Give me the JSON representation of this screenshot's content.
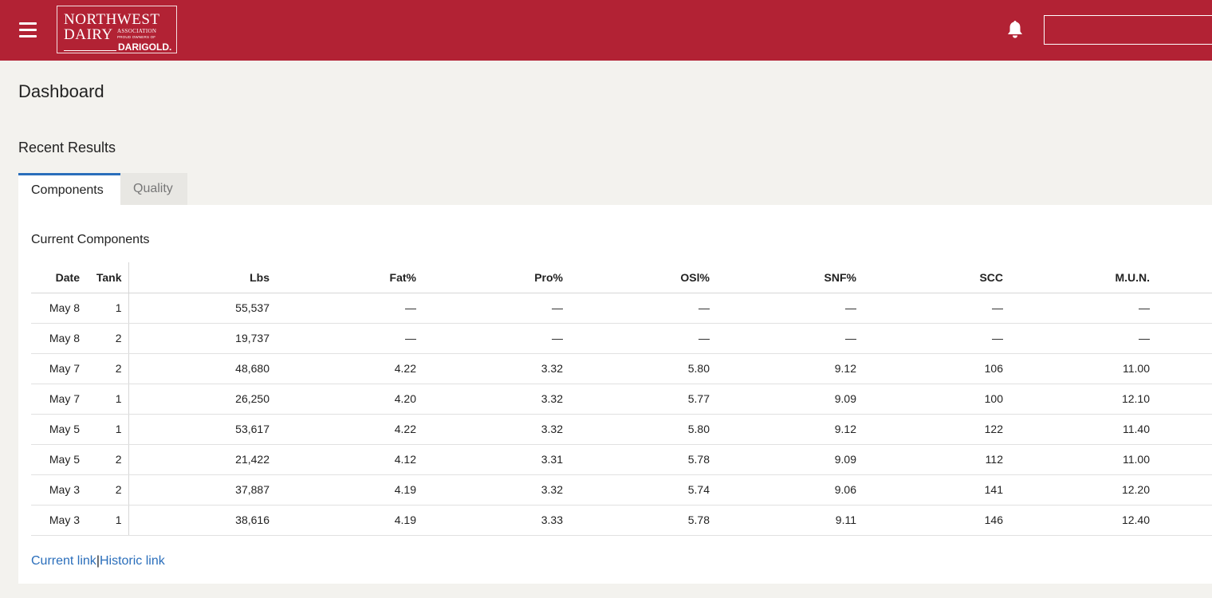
{
  "header": {
    "logo": {
      "line1": "NORTHWEST",
      "line2": "DAIRY",
      "line3": "ASSOCIATION",
      "line4": "PROUD OWNERS OF",
      "line5": "DARIGOLD."
    },
    "search": {
      "value": "",
      "placeholder": ""
    },
    "colors": {
      "brand": "#b22234",
      "accent": "#2a6ebb"
    },
    "icons": {
      "menu": "hamburger-menu-icon",
      "notifications": "bell-icon"
    }
  },
  "page": {
    "title": "Dashboard"
  },
  "recent": {
    "title": "Recent Results",
    "tabs": [
      {
        "label": "Components",
        "active": true
      },
      {
        "label": "Quality",
        "active": false
      }
    ],
    "panel_title": "Current Components",
    "columns": [
      "Date",
      "Tank",
      "Lbs",
      "Fat%",
      "Pro%",
      "OSl%",
      "SNF%",
      "SCC",
      "M.U.N."
    ],
    "rows": [
      [
        "May 8",
        "1",
        "55,537",
        "—",
        "—",
        "—",
        "—",
        "—",
        "—"
      ],
      [
        "May 8",
        "2",
        "19,737",
        "—",
        "—",
        "—",
        "—",
        "—",
        "—"
      ],
      [
        "May 7",
        "2",
        "48,680",
        "4.22",
        "3.32",
        "5.80",
        "9.12",
        "106",
        "11.00"
      ],
      [
        "May 7",
        "1",
        "26,250",
        "4.20",
        "3.32",
        "5.77",
        "9.09",
        "100",
        "12.10"
      ],
      [
        "May 5",
        "1",
        "53,617",
        "4.22",
        "3.32",
        "5.80",
        "9.12",
        "122",
        "11.40"
      ],
      [
        "May 5",
        "2",
        "21,422",
        "4.12",
        "3.31",
        "5.78",
        "9.09",
        "112",
        "11.00"
      ],
      [
        "May 3",
        "2",
        "37,887",
        "4.19",
        "3.32",
        "5.74",
        "9.06",
        "141",
        "12.20"
      ],
      [
        "May 3",
        "1",
        "38,616",
        "4.19",
        "3.33",
        "5.78",
        "9.11",
        "146",
        "12.40"
      ]
    ],
    "links": {
      "current": "Current link",
      "separator": "|",
      "historic": "Historic link"
    }
  }
}
